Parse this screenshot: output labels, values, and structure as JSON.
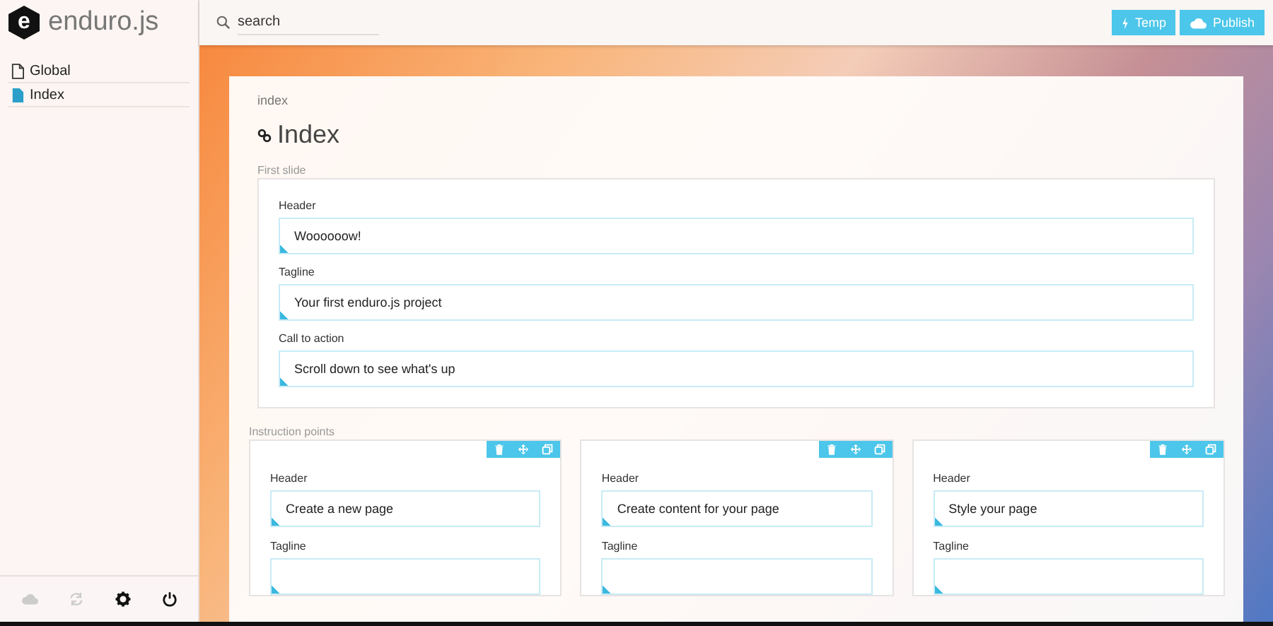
{
  "logo": {
    "letter": "e",
    "name": "enduro.js"
  },
  "sidebar": {
    "items": [
      {
        "label": "Global",
        "selected": false
      },
      {
        "label": "Index",
        "selected": true
      }
    ],
    "footer": [
      {
        "kind": "cloud",
        "disabled": true
      },
      {
        "kind": "refresh",
        "disabled": true
      },
      {
        "kind": "settings",
        "disabled": false
      },
      {
        "kind": "power",
        "disabled": false
      }
    ]
  },
  "search": {
    "placeholder": "search"
  },
  "buttons": [
    {
      "kind": "bolt",
      "label": "Temp"
    },
    {
      "kind": "cloud",
      "label": "Publish"
    }
  ],
  "page": {
    "breadcrumb": "index",
    "title": "Index",
    "first_slide": {
      "label": "First slide",
      "fields": [
        {
          "label": "Header",
          "value": "Woooooow!"
        },
        {
          "label": "Tagline",
          "value": "Your first enduro.js project"
        },
        {
          "label": "Call to action",
          "value": "Scroll down to see what's up"
        }
      ]
    },
    "instruction_points": {
      "label": "Instruction points",
      "cards": [
        {
          "fields": [
            {
              "label": "Header",
              "value": "Create a new page"
            },
            {
              "label": "Tagline"
            }
          ]
        },
        {
          "fields": [
            {
              "label": "Header",
              "value": "Create content for your page"
            },
            {
              "label": "Tagline"
            }
          ]
        },
        {
          "fields": [
            {
              "label": "Header",
              "value": "Style your page"
            },
            {
              "label": "Tagline"
            }
          ]
        }
      ]
    }
  }
}
